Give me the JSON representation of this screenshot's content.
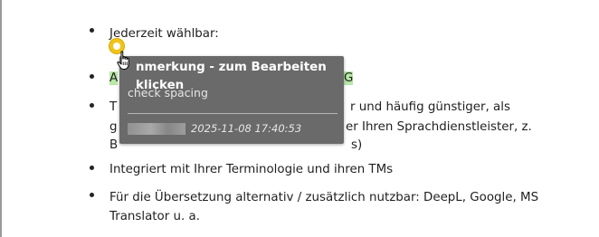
{
  "document": {
    "bullets": [
      {
        "line1": "Jederzeit wählbar:"
      },
      {
        "line1_start": "A",
        "line1_end": "G"
      },
      {
        "line1_start": "T",
        "line1_end": "r und häufig günstiger, als",
        "line2_start": "g",
        "line2_end": "er Ihren Sprachdienstleister, z.",
        "line3_start": "B",
        "line3_end": "s)"
      },
      {
        "line1": "Integriert mit Ihrer Terminologie und ihren TMs"
      },
      {
        "line1": "Für die Übersetzung alternativ / zusätzlich nutzbar: DeepL, Google, MS",
        "line2": "Translator u. a."
      }
    ]
  },
  "comment_tooltip": {
    "title": "nmerkung - zum Bearbeiten klicken",
    "body": "check spacing",
    "timestamp": "2025-11-08 17:40:53"
  },
  "colors": {
    "highlight": "#b7e8a6",
    "tooltip_bg": "#5f5f5f",
    "comment_marker": "#f0c419"
  }
}
